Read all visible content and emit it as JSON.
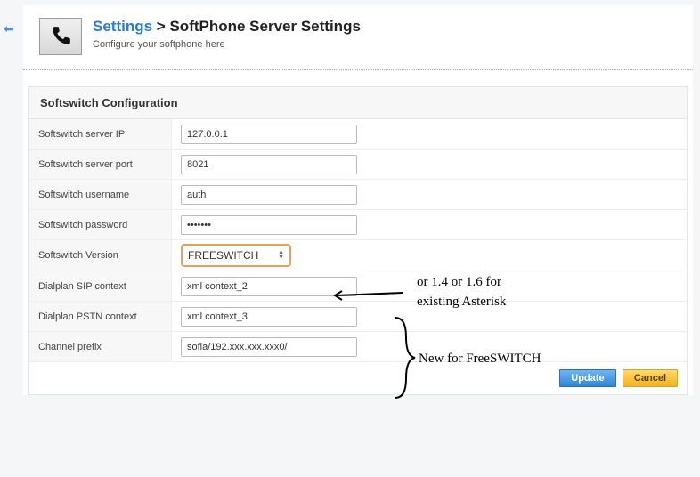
{
  "header": {
    "breadcrumb_link": "Settings",
    "breadcrumb_sep": ">",
    "page_title": "SoftPhone Server Settings",
    "subtitle": "Configure your softphone here"
  },
  "panel": {
    "title": "Softswitch Configuration"
  },
  "fields": {
    "server_ip": {
      "label": "Softswitch server IP",
      "value": "127.0.0.1"
    },
    "server_port": {
      "label": "Softswitch server port",
      "value": "8021"
    },
    "username": {
      "label": "Softswitch username",
      "value": "auth"
    },
    "password": {
      "label": "Softswitch password",
      "value": "•••••••"
    },
    "version": {
      "label": "Softswitch Version",
      "value": "FREESWITCH"
    },
    "sip_context": {
      "label": "Dialplan SIP context",
      "value": "xml context_2"
    },
    "pstn_context": {
      "label": "Dialplan PSTN context",
      "value": "xml context_3"
    },
    "channel_prefix": {
      "label": "Channel prefix",
      "value": "sofia/192.xxx.xxx.xxx0/"
    }
  },
  "buttons": {
    "update": "Update",
    "cancel": "Cancel"
  },
  "annotations": {
    "line1": "or 1.4 or 1.6 for",
    "line2": "existing Asterisk",
    "line3": "New for FreeSWITCH"
  }
}
